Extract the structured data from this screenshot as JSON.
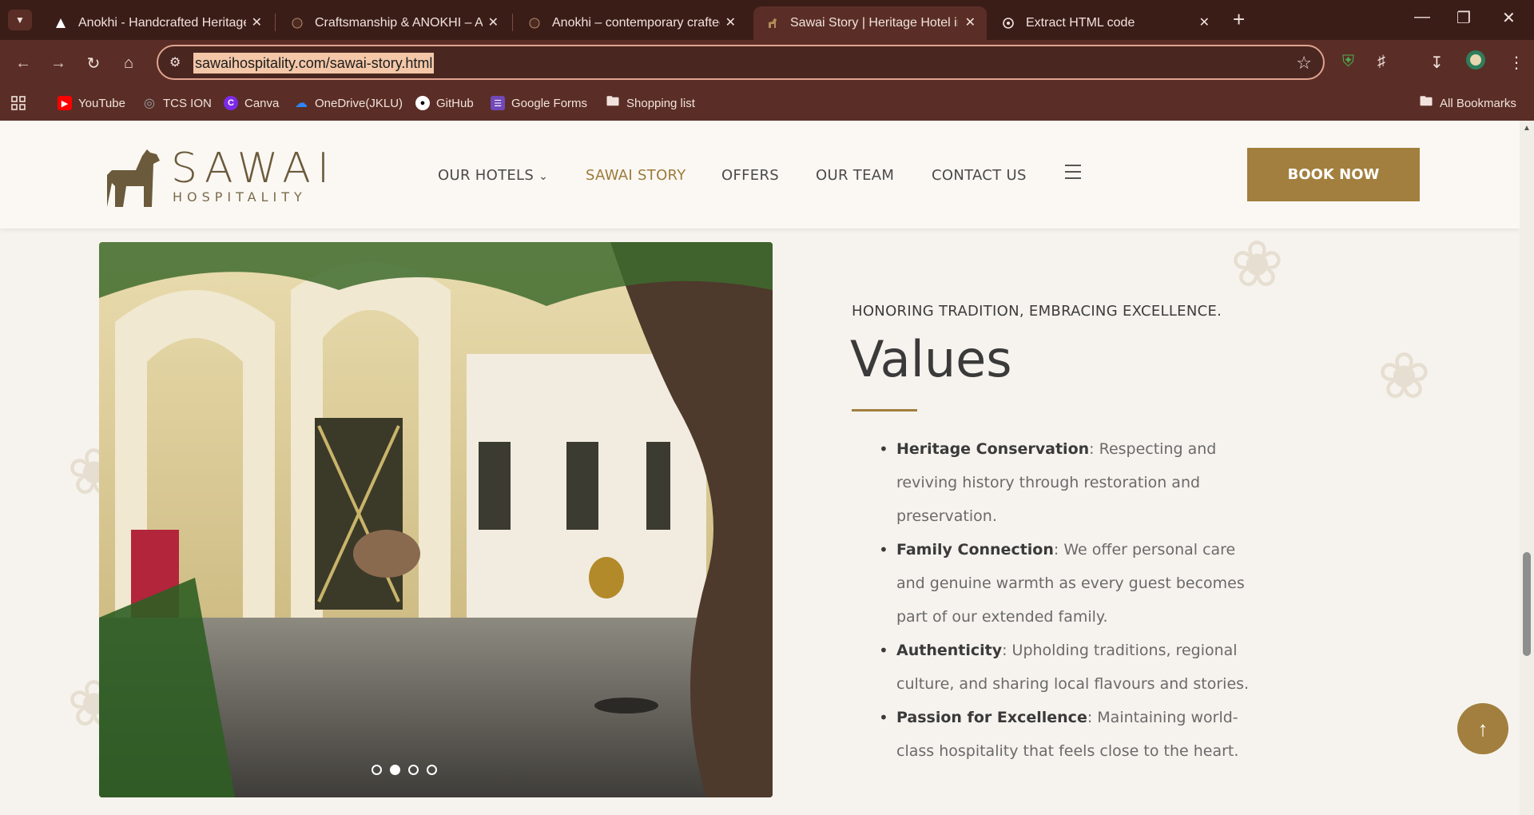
{
  "browser": {
    "tabs": [
      {
        "title": "Anokhi - Handcrafted Heritage,",
        "active": false
      },
      {
        "title": "Craftsmanship & ANOKHI – Ano",
        "active": false
      },
      {
        "title": "Anokhi – contemporary crafted",
        "active": false
      },
      {
        "title": "Sawai Story | Heritage Hotel in I",
        "active": true
      },
      {
        "title": "Extract HTML code",
        "active": false
      }
    ],
    "url": "sawaihospitality.com/sawai-story.html",
    "bookmarks": [
      {
        "label": "YouTube",
        "icon": "youtube-icon",
        "color": "#ff0000"
      },
      {
        "label": "TCS ION",
        "icon": "globe-icon",
        "color": "#9aa0a6"
      },
      {
        "label": "Canva",
        "icon": "canva-icon",
        "color": "#7d2ae8"
      },
      {
        "label": "OneDrive(JKLU)",
        "icon": "onedrive-icon",
        "color": "#0a64d6"
      },
      {
        "label": "GitHub",
        "icon": "github-icon",
        "color": "#ffffff"
      },
      {
        "label": "Google Forms",
        "icon": "google-forms-icon",
        "color": "#7248b9"
      },
      {
        "label": "Shopping list",
        "icon": "folder-icon",
        "color": "#f1e2dd"
      }
    ],
    "all_bookmarks": "All Bookmarks"
  },
  "site": {
    "logo": {
      "word1": "SAWAI",
      "word2": "HOSPITALITY"
    },
    "nav": [
      {
        "label": "OUR HOTELS",
        "has_dropdown": true,
        "active": false
      },
      {
        "label": "SAWAI STORY",
        "has_dropdown": false,
        "active": true
      },
      {
        "label": "OFFERS",
        "has_dropdown": false,
        "active": false
      },
      {
        "label": "OUR TEAM",
        "has_dropdown": false,
        "active": false
      },
      {
        "label": "CONTACT US",
        "has_dropdown": false,
        "active": false
      }
    ],
    "book_now": "BOOK NOW",
    "accent_color": "#a27f3e"
  },
  "content": {
    "kicker": "HONORING TRADITION, EMBRACING EXCELLENCE.",
    "heading": "Values",
    "values": [
      {
        "title": "Heritage Conservation",
        "text": ": Respecting and reviving history through restoration and preservation."
      },
      {
        "title": "Family Connection",
        "text": ": We offer personal care and genuine warmth as every guest becomes part of our extended family."
      },
      {
        "title": "Authenticity",
        "text": ": Upholding traditions, regional culture, and sharing local flavours and stories."
      },
      {
        "title": "Passion for Excellence",
        "text": ": Maintaining world-class hospitality that feels close to the heart."
      }
    ],
    "carousel": {
      "slides": 4,
      "active_index": 1
    }
  }
}
